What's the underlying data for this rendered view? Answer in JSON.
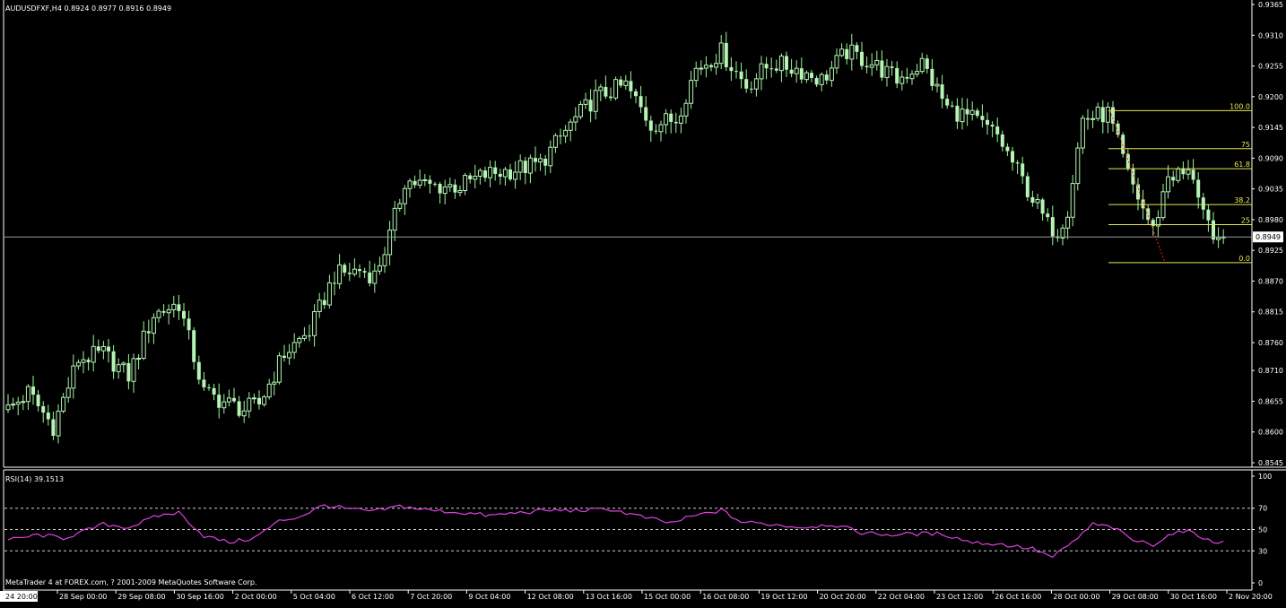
{
  "window": {
    "symbol_header": "AUDUSDFXF,H4  0.8924 0.8977 0.8916 0.8949",
    "current_price_label": "0.8949",
    "copyright": "MetaTrader 4 at FOREX.com, ? 2001-2009 MetaQuotes Software Corp."
  },
  "rsi": {
    "header": "RSI(14) 39.1513",
    "levels": [
      70,
      50,
      30
    ],
    "tick_labels": [
      "100",
      "70",
      "50",
      "30",
      "0"
    ]
  },
  "fib": {
    "labels": [
      "100.0",
      "75",
      "61.8",
      "38.2",
      "25",
      "0.0"
    ],
    "high": 0.9175,
    "low": 0.8903
  },
  "colors": {
    "background": "#000000",
    "axis": "#FFFFFF",
    "candle": "#B6F4B6",
    "wick": "#9CF79C",
    "rsi_line": "#E040E0",
    "fib": "#E8E850",
    "trend": "#FF2020",
    "price_line": "#9A9A9A"
  },
  "chart_data": {
    "type": "candlestick",
    "symbol": "AUDUSDFXF",
    "timeframe": "H4",
    "ylim": [
      0.8545,
      0.9365
    ],
    "y_tick_labels": [
      "0.9365",
      "0.9310",
      "0.9255",
      "0.9200",
      "0.9145",
      "0.9090",
      "0.9035",
      "0.8980",
      "0.8925",
      "0.8870",
      "0.8815",
      "0.8760",
      "0.8710",
      "0.8655",
      "0.8600",
      "0.8545"
    ],
    "x_tick_labels": [
      "24 20:00",
      "28 Sep 00:00",
      "29 Sep 08:00",
      "30 Sep 16:00",
      "2 Oct 00:00",
      "5 Oct 04:00",
      "6 Oct 12:00",
      "7 Oct 20:00",
      "9 Oct 04:00",
      "12 Oct 08:00",
      "13 Oct 16:00",
      "15 Oct 00:00",
      "16 Oct 08:00",
      "19 Oct 12:00",
      "20 Oct 20:00",
      "22 Oct 04:00",
      "23 Oct 12:00",
      "26 Oct 16:00",
      "28 Oct 00:00",
      "29 Oct 08:00",
      "30 Oct 16:00",
      "2 Nov 20:00"
    ],
    "ohlc_knots": [
      [
        0,
        0.864
      ],
      [
        4,
        0.867
      ],
      [
        9,
        0.861
      ],
      [
        14,
        0.873
      ],
      [
        19,
        0.874
      ],
      [
        24,
        0.87
      ],
      [
        29,
        0.881
      ],
      [
        34,
        0.883
      ],
      [
        39,
        0.867
      ],
      [
        44,
        0.865
      ],
      [
        47,
        0.864
      ],
      [
        50,
        0.865
      ],
      [
        55,
        0.874
      ],
      [
        60,
        0.878
      ],
      [
        65,
        0.888
      ],
      [
        70,
        0.889
      ],
      [
        73,
        0.888
      ],
      [
        76,
        0.895
      ],
      [
        79,
        0.905
      ],
      [
        84,
        0.904
      ],
      [
        90,
        0.904
      ],
      [
        95,
        0.906
      ],
      [
        101,
        0.907
      ],
      [
        106,
        0.908
      ],
      [
        112,
        0.915
      ],
      [
        117,
        0.92
      ],
      [
        123,
        0.922
      ],
      [
        128,
        0.915
      ],
      [
        133,
        0.916
      ],
      [
        137,
        0.925
      ],
      [
        142,
        0.928
      ],
      [
        147,
        0.922
      ],
      [
        152,
        0.926
      ],
      [
        157,
        0.925
      ],
      [
        162,
        0.923
      ],
      [
        167,
        0.928
      ],
      [
        172,
        0.926
      ],
      [
        177,
        0.923
      ],
      [
        182,
        0.926
      ],
      [
        187,
        0.918
      ],
      [
        192,
        0.916
      ],
      [
        197,
        0.913
      ],
      [
        202,
        0.905
      ],
      [
        207,
        0.897
      ],
      [
        209,
        0.896
      ],
      [
        211,
        0.9
      ],
      [
        214,
        0.916
      ],
      [
        219,
        0.917
      ],
      [
        223,
        0.906
      ],
      [
        228,
        0.896
      ],
      [
        231,
        0.906
      ],
      [
        236,
        0.906
      ],
      [
        240,
        0.893
      ],
      [
        242,
        0.8949
      ]
    ],
    "rsi_knots": [
      [
        0,
        40
      ],
      [
        6,
        45
      ],
      [
        11,
        42
      ],
      [
        15,
        48
      ],
      [
        19,
        55
      ],
      [
        24,
        52
      ],
      [
        30,
        63
      ],
      [
        34,
        66
      ],
      [
        39,
        44
      ],
      [
        44,
        38
      ],
      [
        49,
        42
      ],
      [
        54,
        58
      ],
      [
        58,
        62
      ],
      [
        63,
        73
      ],
      [
        68,
        69
      ],
      [
        73,
        67
      ],
      [
        78,
        72
      ],
      [
        84,
        68
      ],
      [
        90,
        66
      ],
      [
        96,
        63
      ],
      [
        102,
        66
      ],
      [
        108,
        68
      ],
      [
        114,
        68
      ],
      [
        120,
        69
      ],
      [
        126,
        62
      ],
      [
        132,
        56
      ],
      [
        136,
        62
      ],
      [
        142,
        68
      ],
      [
        146,
        57
      ],
      [
        152,
        55
      ],
      [
        158,
        52
      ],
      [
        164,
        55
      ],
      [
        170,
        47
      ],
      [
        176,
        45
      ],
      [
        180,
        46
      ],
      [
        186,
        46
      ],
      [
        192,
        38
      ],
      [
        198,
        36
      ],
      [
        204,
        32
      ],
      [
        208,
        24
      ],
      [
        212,
        38
      ],
      [
        216,
        55
      ],
      [
        220,
        52
      ],
      [
        224,
        40
      ],
      [
        228,
        36
      ],
      [
        232,
        47
      ],
      [
        236,
        48
      ],
      [
        240,
        37
      ],
      [
        242,
        39.15
      ]
    ]
  }
}
